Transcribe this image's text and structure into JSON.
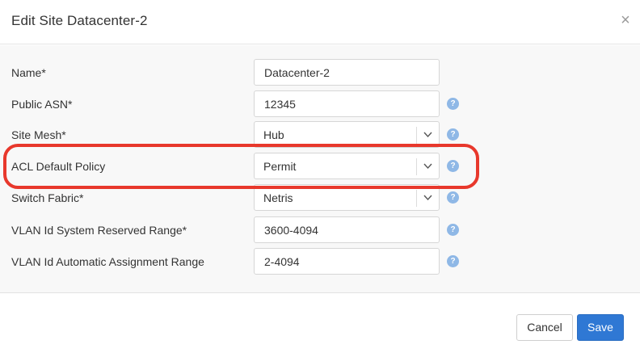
{
  "dialog": {
    "title": "Edit Site Datacenter-2",
    "close_symbol": "×"
  },
  "fields": [
    {
      "label": "Name*",
      "type": "text",
      "value": "Datacenter-2",
      "help": false
    },
    {
      "label": "Public ASN*",
      "type": "text",
      "value": "12345",
      "help": true
    },
    {
      "label": "Site Mesh*",
      "type": "select",
      "value": "Hub",
      "help": true
    },
    {
      "label": "ACL Default Policy",
      "type": "select",
      "value": "Permit",
      "help": true,
      "highlighted": true
    },
    {
      "label": "Switch Fabric*",
      "type": "select",
      "value": "Netris",
      "help": true
    },
    {
      "label": "VLAN Id System Reserved Range*",
      "type": "text",
      "value": "3600-4094",
      "help": true
    },
    {
      "label": "VLAN Id Automatic Assignment Range",
      "type": "text",
      "value": "2-4094",
      "help": true
    }
  ],
  "help_symbol": "?",
  "footer": {
    "cancel_label": "Cancel",
    "save_label": "Save"
  },
  "colors": {
    "primary": "#2f78d4",
    "help_icon": "#8fb8e6",
    "highlight": "#e8382c",
    "body_background": "#f8f8f8"
  },
  "icons": {
    "close": "close-icon",
    "chevron": "chevron-down-icon",
    "help": "help-icon"
  }
}
